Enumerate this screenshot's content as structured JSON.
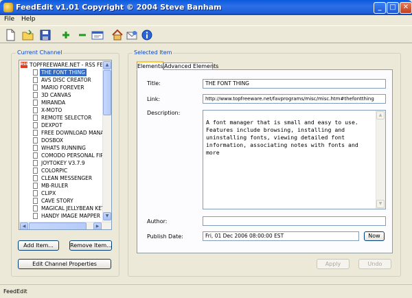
{
  "window": {
    "title": "FeedEdit v1.01 Copyright © 2004 Steve Banham"
  },
  "menu": {
    "items": [
      "File",
      "Help"
    ]
  },
  "toolbar": {
    "buttons": [
      "new-file-icon",
      "open-folder-icon",
      "save-icon",
      "add-icon",
      "remove-icon",
      "edit-channel-icon",
      "home-icon",
      "email-icon",
      "info-icon"
    ]
  },
  "channel_panel": {
    "label": "Current Channel",
    "root": "TOPFREEWARE.NET - RSS FE",
    "items": [
      "THE FONT THING",
      "AVS DISC CREATOR",
      "MARIO FOREVER",
      "3D CANVAS",
      "MIRANDA",
      "X-MOTO",
      "REMOTE SELECTOR",
      "DEXPOT",
      "FREE DOWNLOAD MANAG",
      "DOSBOX",
      "WHATS RUNNING",
      "COMODO PERSONAL FIRE",
      "JOYTOKEY V3.7.9",
      "COLORPIC",
      "CLEAN MESSENGER",
      "MB-RULER",
      "CLIPX",
      "CAVE STORY",
      "MAGICAL JELLYBEAN KEY",
      "HANDY IMAGE MAPPER"
    ],
    "selected_index": 0,
    "add_button": "Add Item...",
    "remove_button": "Remove Item...",
    "edit_button": "Edit Channel Properties"
  },
  "item_panel": {
    "label": "Selected Item",
    "tabs": [
      "Elements",
      "Advanced Elements"
    ],
    "active_tab": 0,
    "title_label": "Title:",
    "title_value": "THE FONT THING",
    "link_label": "Link:",
    "link_value": "http://www.topfreeware.net/favprograms/misc/misc.htm#thefontthing",
    "description_label": "Description:",
    "description_value": "A font manager that is small and easy to use.\nFeatures include browsing, installing and uninstalling fonts, viewing detailed font information, associating notes with fonts and more",
    "author_label": "Author:",
    "author_value": "",
    "date_label": "Publish Date:",
    "date_value": "Fri, 01 Dec 2006 08:00:00 EST",
    "now_button": "Now",
    "apply_button": "Apply",
    "undo_button": "Undo"
  },
  "status": {
    "text": "FeedEdit"
  },
  "colors": {
    "titlebar": "#0a5bdc",
    "selection": "#316ac5",
    "group_label": "#0046d5",
    "background": "#ece9d8"
  }
}
